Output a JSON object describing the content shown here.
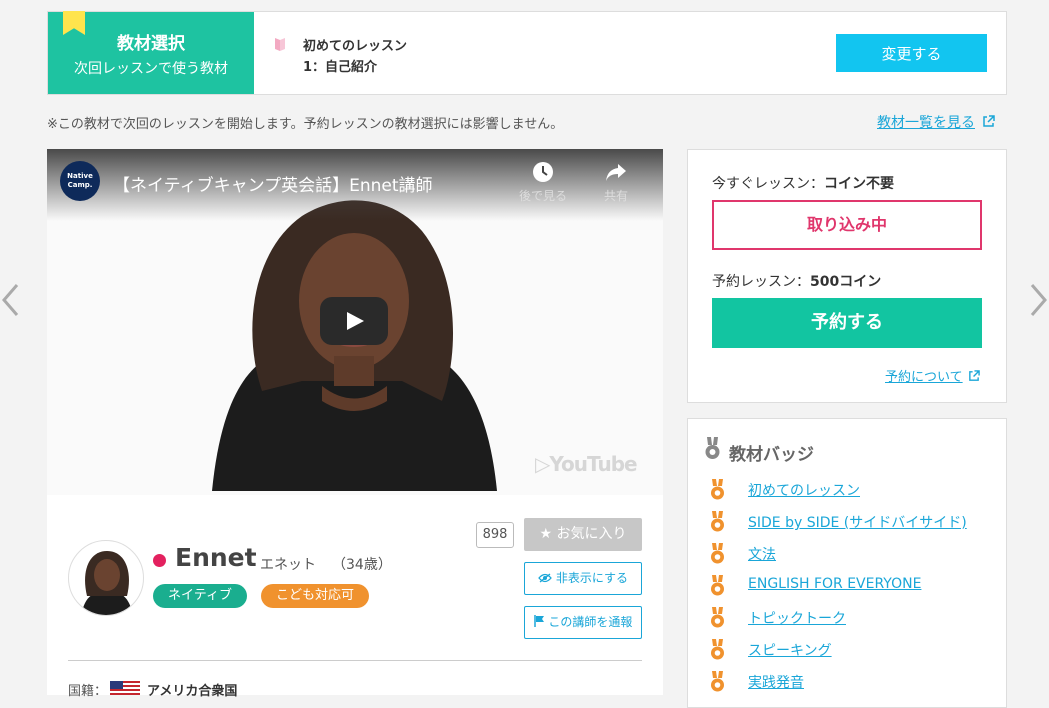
{
  "material": {
    "label_title": "教材選択",
    "label_sub": "次回レッスンで使う教材",
    "book_name": "初めてのレッスン",
    "lesson": "1：自己紹介",
    "change_button": "変更する",
    "accent_color": "#1ec3a1"
  },
  "notice": "※この教材で次回のレッスンを開始します。予約レッスンの教材選択には影響しません。",
  "material_list_link": "教材一覧を見る",
  "video": {
    "channel_logo_line1": "Native",
    "channel_logo_line2": "Camp.",
    "title": "【ネイティブキャンプ英会話】Ennet講師",
    "watch_later": "後で見る",
    "share": "共有",
    "brand": "YouTube"
  },
  "teacher": {
    "name": "Ennet",
    "kana": "エネット",
    "age": "（34歳）",
    "badges": [
      "ネイティブ",
      "こども対応可"
    ],
    "favorite_count": "898",
    "favorite_button": "お気に入り",
    "hide_button": "非表示にする",
    "report_button": "この講師を通報",
    "country_label": "国籍：",
    "country": "アメリカ合衆国",
    "status_color": "#e3215f"
  },
  "booking": {
    "now_label": "今すぐレッスン：",
    "now_value": "コイン不要",
    "busy_button": "取り込み中",
    "reserve_label": "予約レッスン：",
    "reserve_value": "500コイン",
    "reserve_button": "予約する",
    "about_link": "予約について"
  },
  "badge_panel": {
    "title": "教材バッジ",
    "items": [
      "初めてのレッスン",
      "SIDE by SIDE (サイドバイサイド)",
      "文法",
      "ENGLISH FOR EVERYONE",
      "トピックトーク",
      "スピーキング",
      "実践発音"
    ]
  }
}
